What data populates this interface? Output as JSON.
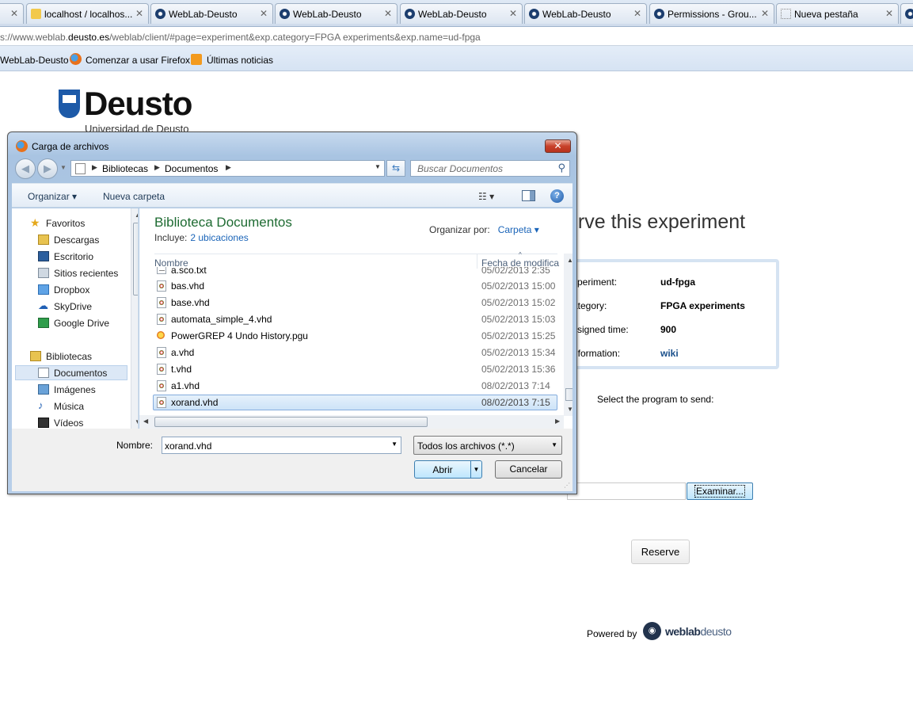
{
  "browser": {
    "tabs": [
      {
        "label": "localhost / localhos..."
      },
      {
        "label": "WebLab-Deusto"
      },
      {
        "label": "WebLab-Deusto"
      },
      {
        "label": "WebLab-Deusto"
      },
      {
        "label": "WebLab-Deusto"
      },
      {
        "label": "Permissions - Grou..."
      },
      {
        "label": "Nueva pestaña"
      }
    ],
    "tab_close_glyph": "✕",
    "address_prefix": "s://www.weblab.",
    "address_host": "deusto.es",
    "address_path": "/weblab/client/#page=experiment&exp.category=FPGA experiments&exp.name=ud-fpga",
    "bookmarks": [
      "WebLab-Deusto",
      "Comenzar a usar Firefox",
      "Últimas noticias"
    ]
  },
  "page": {
    "logo_text": "Deusto",
    "logo_subtitle": "Universidad de Deusto",
    "heading": "erve this experiment",
    "info": [
      {
        "key": "xperiment:",
        "value": "ud-fpga"
      },
      {
        "key": "ategory:",
        "value": "FPGA experiments"
      },
      {
        "key": "ssigned time:",
        "value": "900"
      },
      {
        "key": "nformation:",
        "value": "wiki"
      }
    ],
    "select_program_label": "Select the program to send:",
    "examinar_label": "Examinar...",
    "reserve_label": "Reserve",
    "powered_by": "Powered by",
    "weblab_brand_bold": "weblab",
    "weblab_brand_light": "deusto"
  },
  "dialog": {
    "title": "Carga de archivos",
    "close_glyph": "✕",
    "breadcrumb": [
      "Bibliotecas",
      "Documentos"
    ],
    "search_placeholder": "Buscar Documentos",
    "toolbar": {
      "organize": "Organizar ▾",
      "new_folder": "Nueva carpeta"
    },
    "nav": {
      "favorites_header": "Favoritos",
      "favorites": [
        "Descargas",
        "Escritorio",
        "Sitios recientes",
        "Dropbox",
        "SkyDrive",
        "Google Drive"
      ],
      "libraries_header": "Bibliotecas",
      "libraries": [
        "Documentos",
        "Imágenes",
        "Música",
        "Vídeos"
      ]
    },
    "library_title": "Biblioteca Documentos",
    "includes_label": "Incluye:",
    "includes_link": "2 ubicaciones",
    "organize_by_label": "Organizar por:",
    "organize_by_value": "Carpeta ▾",
    "columns": {
      "name": "Nombre",
      "date": "Fecha de modifica"
    },
    "files": [
      {
        "name": "a.sco.txt",
        "date": "05/02/2013 2:35",
        "kind": "txt"
      },
      {
        "name": "bas.vhd",
        "date": "05/02/2013 15:00",
        "kind": "vhd"
      },
      {
        "name": "base.vhd",
        "date": "05/02/2013 15:02",
        "kind": "vhd"
      },
      {
        "name": "automata_simple_4.vhd",
        "date": "05/02/2013 15:03",
        "kind": "vhd"
      },
      {
        "name": "PowerGREP 4 Undo History.pgu",
        "date": "05/02/2013 15:25",
        "kind": "pgu"
      },
      {
        "name": "a.vhd",
        "date": "05/02/2013 15:34",
        "kind": "vhd"
      },
      {
        "name": "t.vhd",
        "date": "05/02/2013 15:36",
        "kind": "vhd"
      },
      {
        "name": "a1.vhd",
        "date": "08/02/2013 7:14",
        "kind": "vhd"
      },
      {
        "name": "xorand.vhd",
        "date": "08/02/2013 7:15",
        "kind": "vhd",
        "selected": true
      }
    ],
    "filename_label": "Nombre:",
    "filename_value": "xorand.vhd",
    "filter_value": "Todos los archivos (*.*)",
    "open_label": "Abrir",
    "cancel_label": "Cancelar"
  }
}
